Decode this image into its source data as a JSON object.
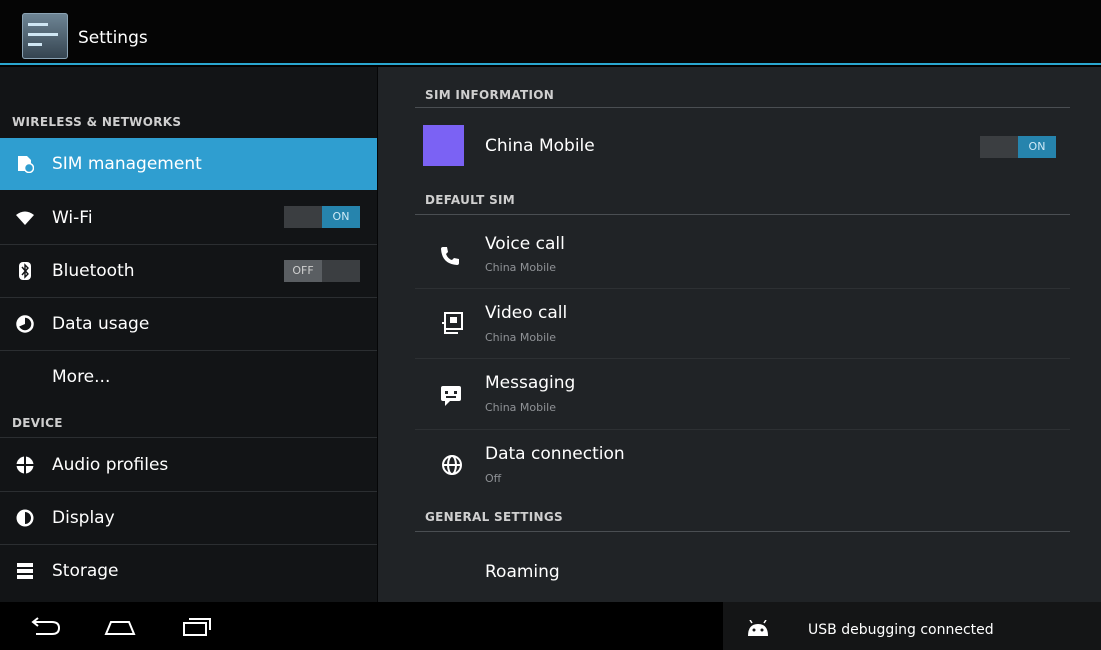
{
  "app": {
    "title": "Settings"
  },
  "left": {
    "sections": {
      "wireless": "WIRELESS & NETWORKS",
      "device": "DEVICE"
    },
    "items": [
      {
        "label": "SIM management",
        "icon": "sim-card-icon",
        "selected": true
      },
      {
        "label": "Wi-Fi",
        "icon": "wifi-icon",
        "toggle": "ON"
      },
      {
        "label": "Bluetooth",
        "icon": "bluetooth-icon",
        "toggle": "OFF"
      },
      {
        "label": "Data usage",
        "icon": "data-usage-icon"
      },
      {
        "label": "More..."
      },
      {
        "label": "Audio profiles",
        "icon": "audio-profiles-icon"
      },
      {
        "label": "Display",
        "icon": "display-icon"
      },
      {
        "label": "Storage",
        "icon": "storage-icon"
      }
    ]
  },
  "right": {
    "sim_information": {
      "header": "SIM INFORMATION",
      "carrier": "China Mobile",
      "toggle": "ON",
      "sim_color": "#7b62f4"
    },
    "default_sim": {
      "header": "DEFAULT SIM",
      "items": [
        {
          "title": "Voice call",
          "subtitle": "China Mobile",
          "icon": "phone-icon"
        },
        {
          "title": "Video call",
          "subtitle": "China Mobile",
          "icon": "video-call-icon"
        },
        {
          "title": "Messaging",
          "subtitle": "China Mobile",
          "icon": "messaging-icon"
        },
        {
          "title": "Data connection",
          "subtitle": "Off",
          "icon": "globe-icon"
        }
      ]
    },
    "general_settings": {
      "header": "GENERAL SETTINGS",
      "items": [
        {
          "title": "Roaming"
        }
      ]
    }
  },
  "navbar": {
    "status": "USB debugging connected"
  },
  "colors": {
    "accent": "#2f9ed0",
    "toggle_on": "#2684ad"
  }
}
